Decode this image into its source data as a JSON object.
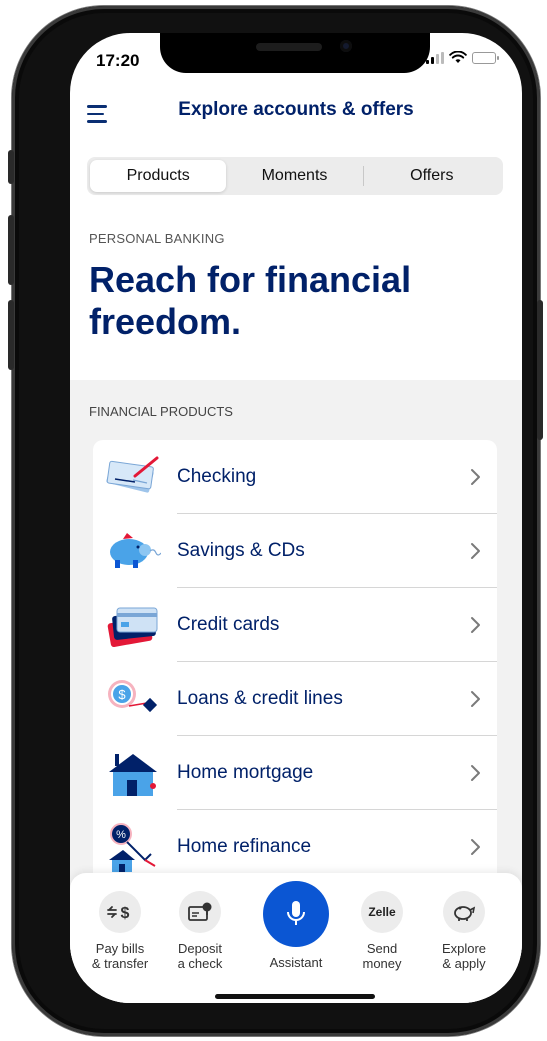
{
  "status_bar": {
    "time": "17:20"
  },
  "header": {
    "title": "Explore accounts & offers"
  },
  "segments": [
    {
      "label": "Products",
      "active": true
    },
    {
      "label": "Moments",
      "active": false
    },
    {
      "label": "Offers",
      "active": false
    }
  ],
  "hero": {
    "eyebrow": "PERSONAL BANKING",
    "title": "Reach for financial freedom."
  },
  "financial_products": {
    "label": "FINANCIAL PRODUCTS",
    "items": [
      {
        "label": "Checking",
        "icon": "checkbook-icon"
      },
      {
        "label": "Savings & CDs",
        "icon": "piggy-bank-icon"
      },
      {
        "label": "Credit cards",
        "icon": "credit-cards-icon"
      },
      {
        "label": "Loans & credit lines",
        "icon": "loan-icon"
      },
      {
        "label": "Home mortgage",
        "icon": "house-icon"
      },
      {
        "label": "Home refinance",
        "icon": "refinance-icon"
      }
    ]
  },
  "bottom_nav": {
    "pay": {
      "label": "Pay bills\n& transfer",
      "icon": "transfer-dollar-icon"
    },
    "deposit": {
      "label": "Deposit\na check",
      "icon": "check-deposit-icon"
    },
    "assistant": {
      "label": "Assistant",
      "icon": "microphone-icon"
    },
    "send": {
      "label": "Send\nmoney",
      "icon": "zelle-icon",
      "zelle_text": "Zelle"
    },
    "explore": {
      "label": "Explore\n& apply",
      "icon": "piggy-bank-icon"
    }
  },
  "colors": {
    "brand_navy": "#012169",
    "accent_blue": "#0b56d3",
    "accent_red": "#e31837"
  }
}
